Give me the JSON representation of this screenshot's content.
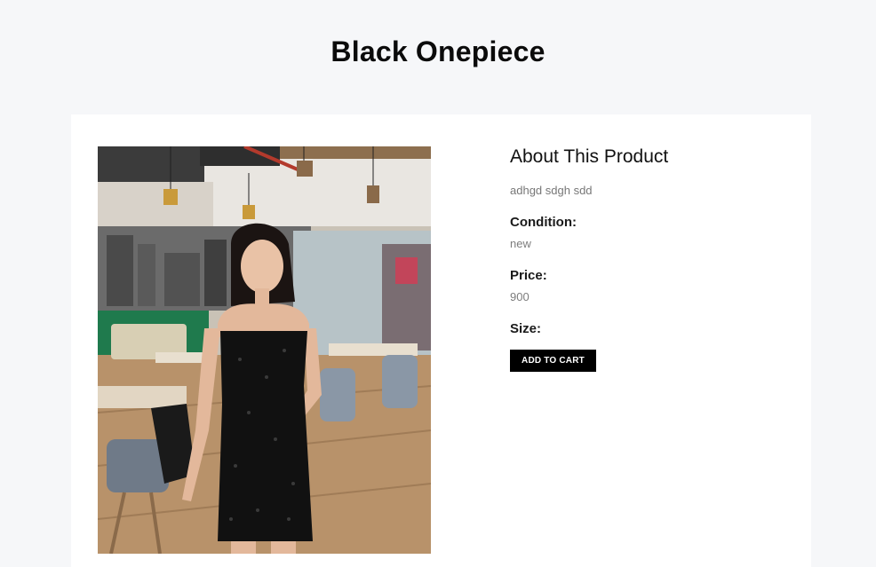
{
  "product": {
    "title": "Black Onepiece",
    "image_alt": "woman in black sequin dress in a cafe"
  },
  "about": {
    "heading": "About This Product",
    "description": "adhgd sdgh sdd"
  },
  "condition": {
    "label": "Condition:",
    "value": "new"
  },
  "price": {
    "label": "Price:",
    "value": "900"
  },
  "size": {
    "label": "Size:"
  },
  "cart": {
    "button_label": "ADD TO CART"
  },
  "colors": {
    "page_bg": "#f6f7f9",
    "card_bg": "#ffffff",
    "button_bg": "#000000"
  }
}
